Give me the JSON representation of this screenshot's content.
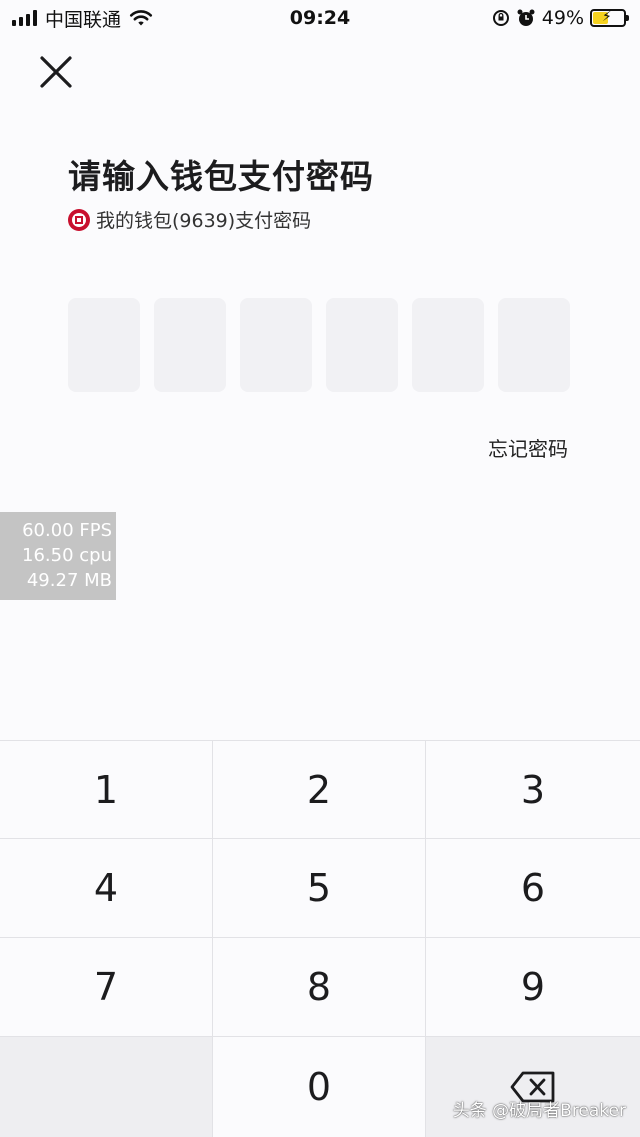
{
  "status_bar": {
    "carrier": "中国联通",
    "time": "09:24",
    "battery": "49%"
  },
  "header": {
    "title": "请输入钱包支付密码",
    "subtitle": "我的钱包(9639)支付密码",
    "bank_icon": "bank-logo-icon"
  },
  "pin": {
    "length": 6,
    "filled": 0
  },
  "forgot_label": "忘记密码",
  "perf_overlay": {
    "fps": "60.00 FPS",
    "cpu": "16.50 cpu",
    "mem": "49.27 MB"
  },
  "keypad": {
    "keys": [
      "1",
      "2",
      "3",
      "4",
      "5",
      "6",
      "7",
      "8",
      "9",
      "",
      "0",
      "delete"
    ]
  },
  "watermark": "头条 @破局者Breaker",
  "colors": {
    "background": "#fbfbfd",
    "pin_box": "#f1f1f4",
    "key_shaded": "#eeeef1",
    "bank_red": "#c8102e",
    "battery_fill": "#f5d21f"
  }
}
